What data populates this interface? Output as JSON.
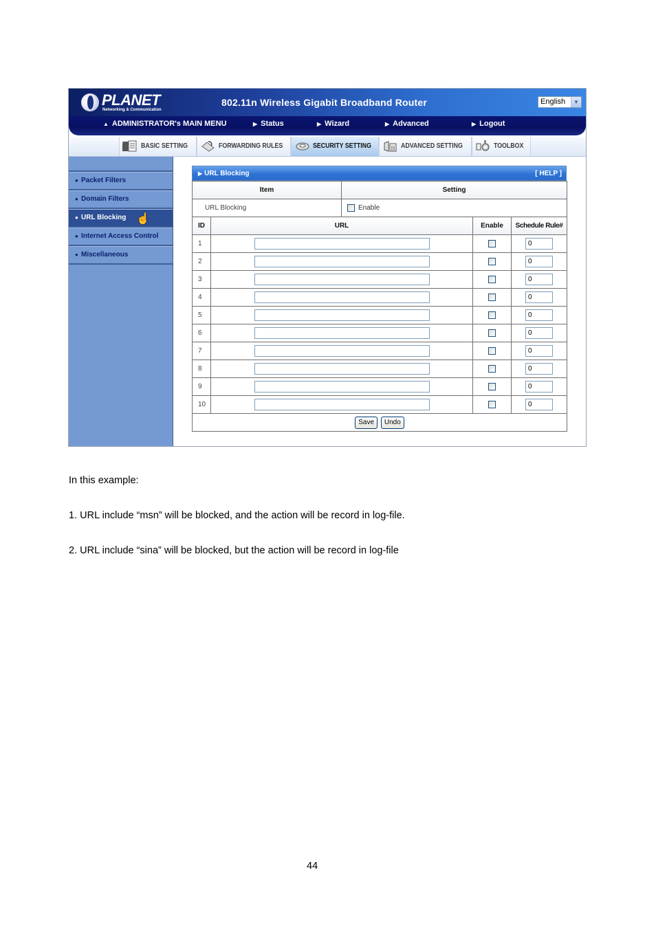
{
  "router": {
    "brand": "PLANET",
    "brand_tagline": "Networking & Communication",
    "product_title": "802.11n Wireless Gigabit Broadband Router",
    "language": {
      "selected": "English"
    },
    "main_menu": [
      {
        "label": "ADMINISTRATOR's MAIN MENU",
        "icon": "person-icon"
      },
      {
        "label": "Status",
        "icon": "arrow-right-icon"
      },
      {
        "label": "Wizard",
        "icon": "arrow-right-icon"
      },
      {
        "label": "Advanced",
        "icon": "arrow-right-icon"
      },
      {
        "label": "Logout",
        "icon": "arrow-right-icon"
      }
    ],
    "tabs": [
      {
        "label": "BASIC SETTING",
        "icon": "folder-document-icon",
        "active": false
      },
      {
        "label": "FORWARDING RULES",
        "icon": "forwarding-icon",
        "active": false
      },
      {
        "label": "SECURITY SETTING",
        "icon": "security-icon",
        "active": true
      },
      {
        "label": "ADVANCED SETTING",
        "icon": "advanced-icon",
        "active": false
      },
      {
        "label": "TOOLBOX",
        "icon": "toolbox-icon",
        "active": false
      }
    ],
    "sidebar": [
      {
        "label": "Packet Filters",
        "active": false
      },
      {
        "label": "Domain Filters",
        "active": false
      },
      {
        "label": "URL Blocking",
        "active": true
      },
      {
        "label": "Internet Access Control",
        "active": false
      },
      {
        "label": "Miscellaneous",
        "active": false
      }
    ],
    "panel": {
      "title": "URL Blocking",
      "help": "[ HELP ]",
      "header_item": "Item",
      "header_setting": "Setting",
      "setting_label": "URL Blocking",
      "setting_enable_label": "Enable",
      "setting_enabled": false,
      "col_id": "ID",
      "col_url": "URL",
      "col_enable": "Enable",
      "col_schedule": "Schedule Rule#",
      "rows": [
        {
          "id": "1",
          "url": "",
          "enabled": false,
          "schedule": "0"
        },
        {
          "id": "2",
          "url": "",
          "enabled": false,
          "schedule": "0"
        },
        {
          "id": "3",
          "url": "",
          "enabled": false,
          "schedule": "0"
        },
        {
          "id": "4",
          "url": "",
          "enabled": false,
          "schedule": "0"
        },
        {
          "id": "5",
          "url": "",
          "enabled": false,
          "schedule": "0"
        },
        {
          "id": "6",
          "url": "",
          "enabled": false,
          "schedule": "0"
        },
        {
          "id": "7",
          "url": "",
          "enabled": false,
          "schedule": "0"
        },
        {
          "id": "8",
          "url": "",
          "enabled": false,
          "schedule": "0"
        },
        {
          "id": "9",
          "url": "",
          "enabled": false,
          "schedule": "0"
        },
        {
          "id": "10",
          "url": "",
          "enabled": false,
          "schedule": "0"
        }
      ],
      "save_label": "Save",
      "undo_label": "Undo"
    }
  },
  "document": {
    "intro": "In this example:",
    "points": [
      "1. URL include “msn” will be blocked, and the action will be record in log-file.",
      "2. URL include “sina” will be blocked, but the action will be record in log-file"
    ],
    "page_number": "44"
  }
}
